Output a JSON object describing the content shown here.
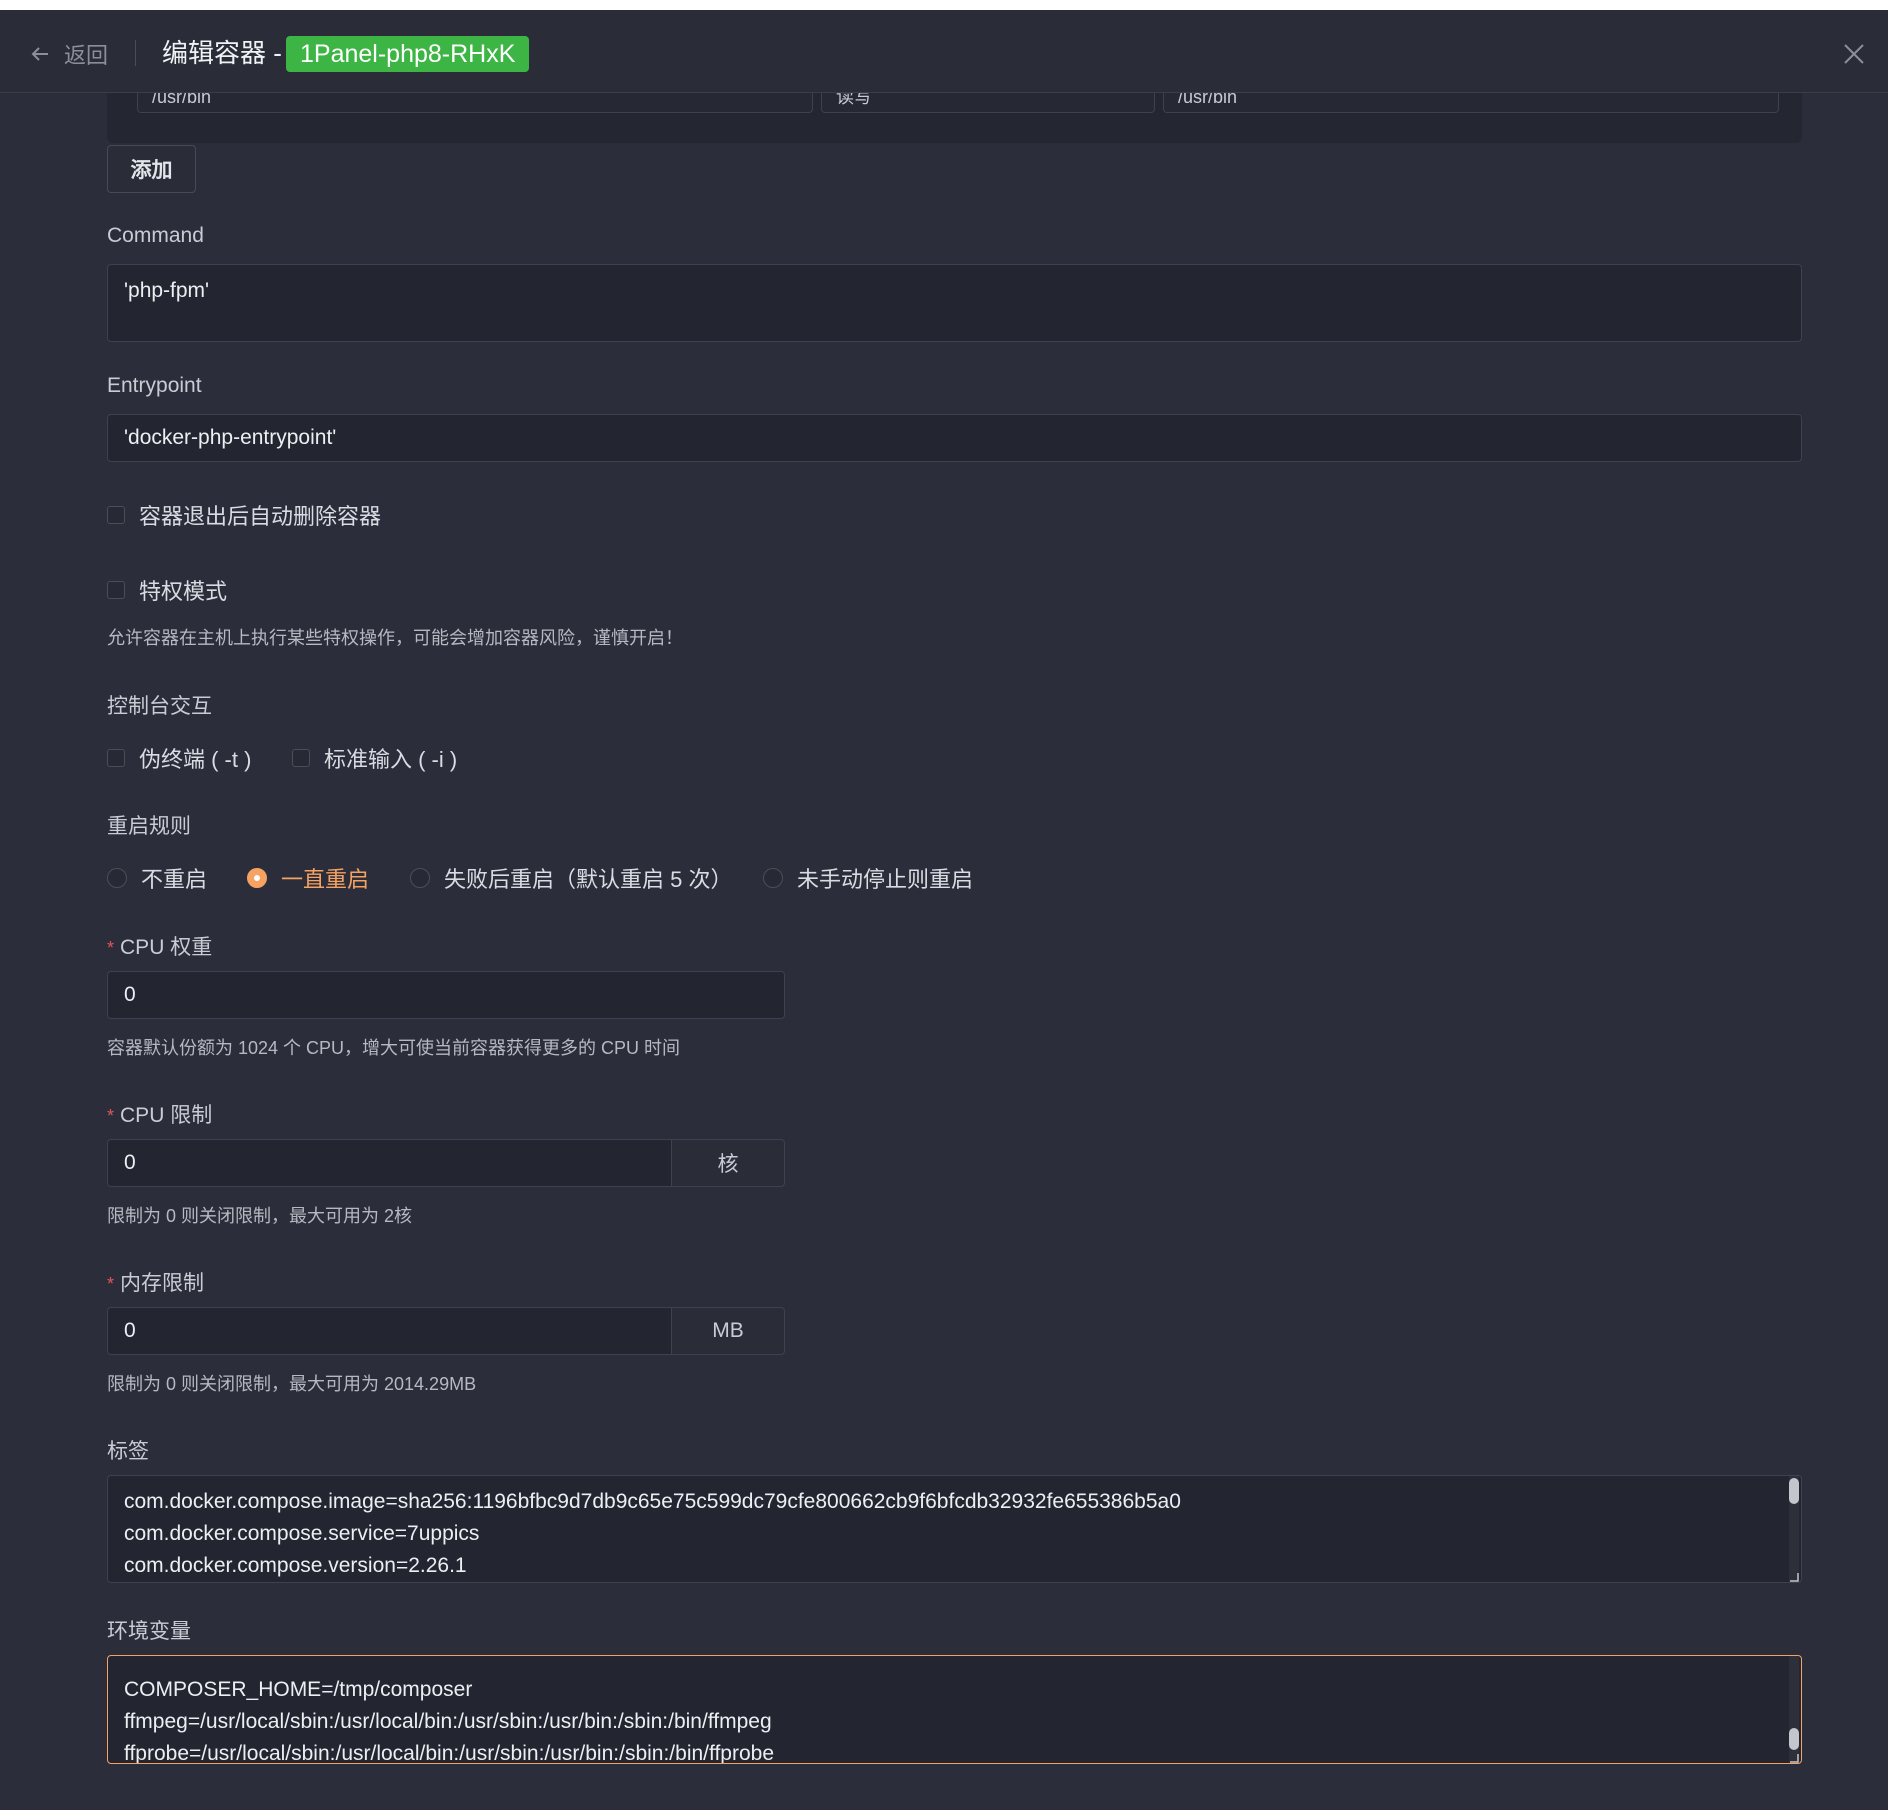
{
  "header": {
    "back_label": "返回",
    "title": "编辑容器 -",
    "container_name": "1Panel-php8-RHxK",
    "tag_color": "#3cb544"
  },
  "volume_row": {
    "host_path": "/usr/bin",
    "mode": "读写",
    "container_path": "/usr/bin"
  },
  "add_button": "添加",
  "command": {
    "label": "Command",
    "value": "'php-fpm'"
  },
  "entrypoint": {
    "label": "Entrypoint",
    "value": "'docker-php-entrypoint'"
  },
  "auto_remove": {
    "label": "容器退出后自动删除容器",
    "checked": false
  },
  "privileged": {
    "label": "特权模式",
    "checked": false,
    "help": "允许容器在主机上执行某些特权操作，可能会增加容器风险，谨慎开启！"
  },
  "console": {
    "label": "控制台交互",
    "tty_label": "伪终端 ( -t )",
    "stdin_label": "标准输入 ( -i )"
  },
  "restart": {
    "label": "重启规则",
    "options": [
      "不重启",
      "一直重启",
      "失败后重启（默认重启 5 次）",
      "未手动停止则重启"
    ],
    "selected": "一直重启",
    "accent": "#f5a262"
  },
  "cpu_weight": {
    "label": "CPU 权重",
    "value": "0",
    "help": "容器默认份额为 1024 个 CPU，增大可使当前容器获得更多的 CPU 时间"
  },
  "cpu_limit": {
    "label": "CPU 限制",
    "value": "0",
    "unit": "核",
    "help": "限制为 0 则关闭限制，最大可用为 2核"
  },
  "memory_limit": {
    "label": "内存限制",
    "value": "0",
    "unit": "MB",
    "help": "限制为 0 则关闭限制，最大可用为 2014.29MB"
  },
  "labels": {
    "label": "标签",
    "lines": [
      "com.docker.compose.image=sha256:1196bfbc9d7db9c65e75c599dc79cfe800662cb9f6bfcdb32932fe655386b5a0",
      "com.docker.compose.service=7uppics",
      "com.docker.compose.version=2.26.1"
    ]
  },
  "env": {
    "label": "环境变量",
    "lines": [
      "COMPOSER_HOME=/tmp/composer",
      "ffmpeg=/usr/local/sbin:/usr/local/bin:/usr/sbin:/usr/bin:/sbin:/bin/ffmpeg",
      "ffprobe=/usr/local/sbin:/usr/local/bin:/usr/sbin:/usr/bin:/sbin:/bin/ffprobe"
    ],
    "focus_color": "#f5a262"
  }
}
